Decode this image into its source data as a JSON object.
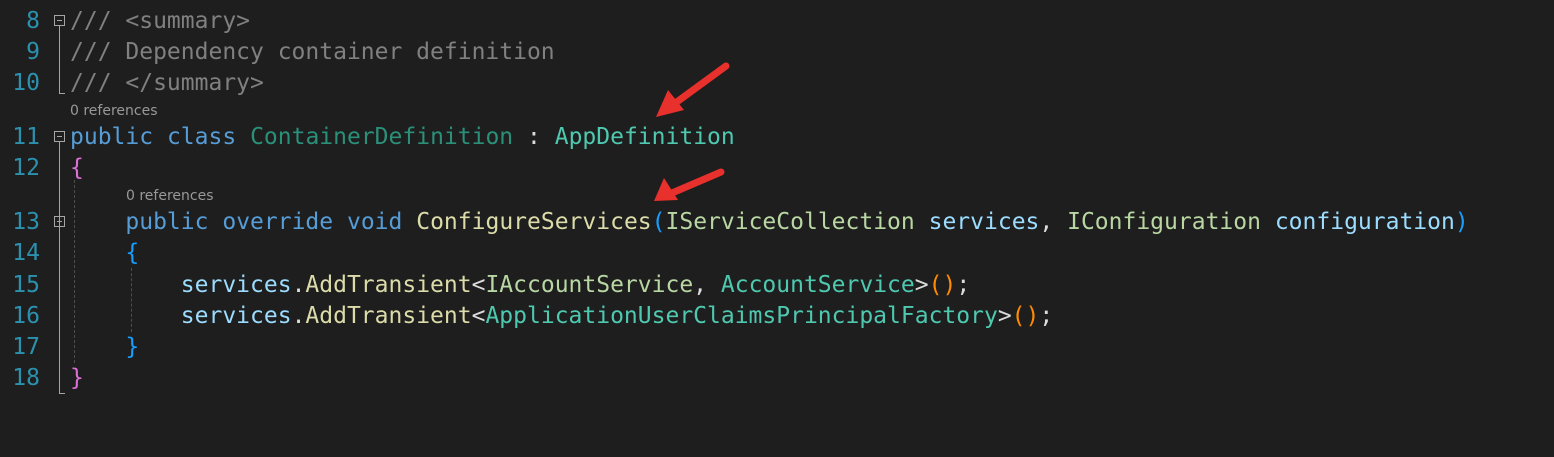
{
  "editor": {
    "lines": [
      {
        "number": "8",
        "tokens": [
          {
            "t": "/// ",
            "c": "c-doc"
          },
          {
            "t": "<summary>",
            "c": "c-doctag"
          }
        ]
      },
      {
        "number": "9",
        "tokens": [
          {
            "t": "/// Dependency container definition",
            "c": "c-doc"
          }
        ]
      },
      {
        "number": "10",
        "tokens": [
          {
            "t": "/// ",
            "c": "c-doc"
          },
          {
            "t": "</summary>",
            "c": "c-doctag"
          }
        ]
      },
      {
        "number": "11",
        "tokens": [
          {
            "t": "public",
            "c": "c-kw"
          },
          {
            "t": " ",
            "c": "c-plain"
          },
          {
            "t": "class",
            "c": "c-kw"
          },
          {
            "t": " ",
            "c": "c-plain"
          },
          {
            "t": "ContainerDefinition",
            "c": "c-classname"
          },
          {
            "t": " : ",
            "c": "c-plain"
          },
          {
            "t": "AppDefinition",
            "c": "c-type"
          }
        ]
      },
      {
        "number": "12",
        "tokens": [
          {
            "t": "{",
            "c": "c-brace1"
          }
        ]
      },
      {
        "number": "13",
        "tokens": [
          {
            "t": "    ",
            "c": "c-plain"
          },
          {
            "t": "public",
            "c": "c-kw"
          },
          {
            "t": " ",
            "c": "c-plain"
          },
          {
            "t": "override",
            "c": "c-kw"
          },
          {
            "t": " ",
            "c": "c-plain"
          },
          {
            "t": "void",
            "c": "c-kw"
          },
          {
            "t": " ",
            "c": "c-plain"
          },
          {
            "t": "ConfigureServices",
            "c": "c-method"
          },
          {
            "t": "(",
            "c": "c-brace2"
          },
          {
            "t": "IServiceCollection",
            "c": "c-iface"
          },
          {
            "t": " ",
            "c": "c-plain"
          },
          {
            "t": "services",
            "c": "c-param"
          },
          {
            "t": ", ",
            "c": "c-plain"
          },
          {
            "t": "IConfiguration",
            "c": "c-iface"
          },
          {
            "t": " ",
            "c": "c-plain"
          },
          {
            "t": "configuration",
            "c": "c-param"
          },
          {
            "t": ")",
            "c": "c-brace2"
          }
        ]
      },
      {
        "number": "14",
        "tokens": [
          {
            "t": "    ",
            "c": "c-plain"
          },
          {
            "t": "{",
            "c": "c-brace2"
          }
        ]
      },
      {
        "number": "15",
        "tokens": [
          {
            "t": "        ",
            "c": "c-plain"
          },
          {
            "t": "services",
            "c": "c-var"
          },
          {
            "t": ".",
            "c": "c-plain"
          },
          {
            "t": "AddTransient",
            "c": "c-method"
          },
          {
            "t": "<",
            "c": "c-plain"
          },
          {
            "t": "IAccountService",
            "c": "c-iface"
          },
          {
            "t": ", ",
            "c": "c-plain"
          },
          {
            "t": "AccountService",
            "c": "c-type"
          },
          {
            "t": ">",
            "c": "c-plain"
          },
          {
            "t": "()",
            "c": "c-paren3"
          },
          {
            "t": ";",
            "c": "c-plain"
          }
        ]
      },
      {
        "number": "16",
        "tokens": [
          {
            "t": "        ",
            "c": "c-plain"
          },
          {
            "t": "services",
            "c": "c-var"
          },
          {
            "t": ".",
            "c": "c-plain"
          },
          {
            "t": "AddTransient",
            "c": "c-method"
          },
          {
            "t": "<",
            "c": "c-plain"
          },
          {
            "t": "ApplicationUserClaimsPrincipalFactory",
            "c": "c-type"
          },
          {
            "t": ">",
            "c": "c-plain"
          },
          {
            "t": "()",
            "c": "c-paren3"
          },
          {
            "t": ";",
            "c": "c-plain"
          }
        ]
      },
      {
        "number": "17",
        "tokens": [
          {
            "t": "    ",
            "c": "c-plain"
          },
          {
            "t": "}",
            "c": "c-brace2"
          }
        ]
      },
      {
        "number": "18",
        "tokens": [
          {
            "t": "}",
            "c": "c-brace1"
          }
        ]
      }
    ],
    "codelens": {
      "class_refs": "0 references",
      "method_refs": "0 references"
    }
  },
  "annotations": {
    "arrow_color": "#e8302c",
    "arrows": [
      {
        "name": "arrow-to-appdefinition",
        "points_to": "AppDefinition"
      },
      {
        "name": "arrow-to-configureservices",
        "points_to": "ConfigureServices"
      }
    ]
  },
  "colors": {
    "background": "#1e1e1e",
    "line_number": "#2b91af",
    "keyword": "#569cd6",
    "type": "#4ec9b0",
    "method": "#dcdcaa",
    "parameter": "#9cdcfe",
    "comment": "#808080",
    "brace_level1": "#da70d6",
    "brace_level2": "#179fff",
    "paren_level3": "#ff8c00"
  }
}
